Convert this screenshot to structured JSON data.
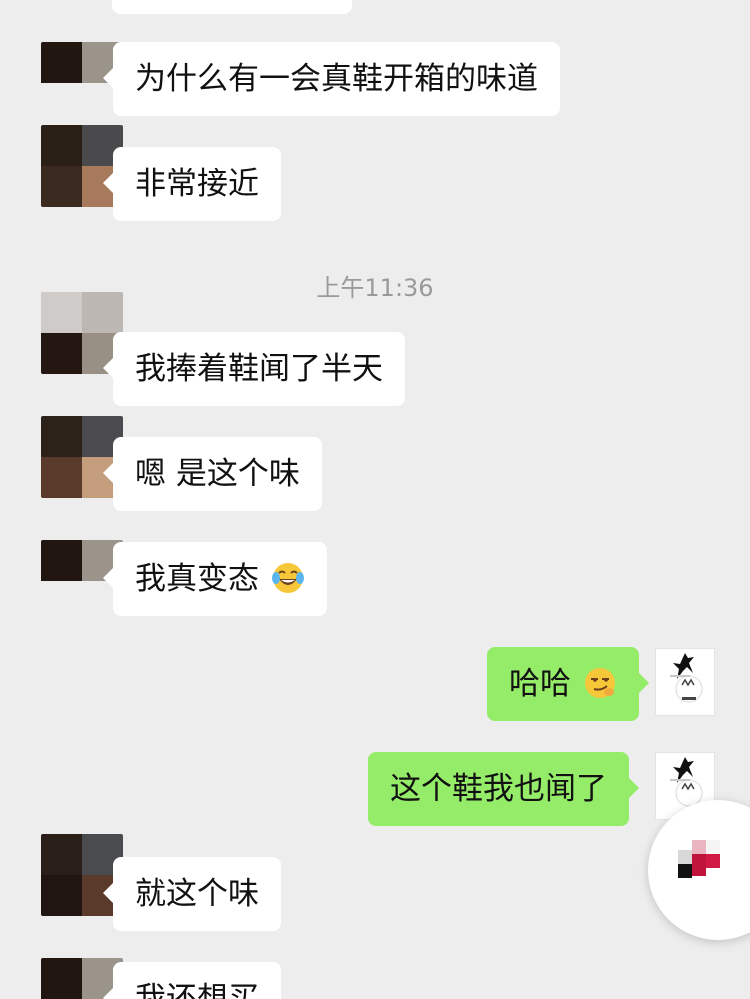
{
  "messages": {
    "m1": "为什么有一会真鞋开箱的味道",
    "m2": "非常接近",
    "timestamp": "上午11:36",
    "m3": "我捧着鞋闻了半天",
    "m4": "嗯 是这个味",
    "m5": "我真变态",
    "m6": "哈哈",
    "m7": "这个鞋我也闻了",
    "m8": "就这个味",
    "m9": "我还想买"
  },
  "emojis": {
    "m5": "tears-of-joy-emoji",
    "m6": "smirk-emoji"
  },
  "colors": {
    "background": "#ededed",
    "received_bubble": "#ffffff",
    "sent_bubble": "#95ec69",
    "timestamp_text": "#9a9a9a"
  }
}
